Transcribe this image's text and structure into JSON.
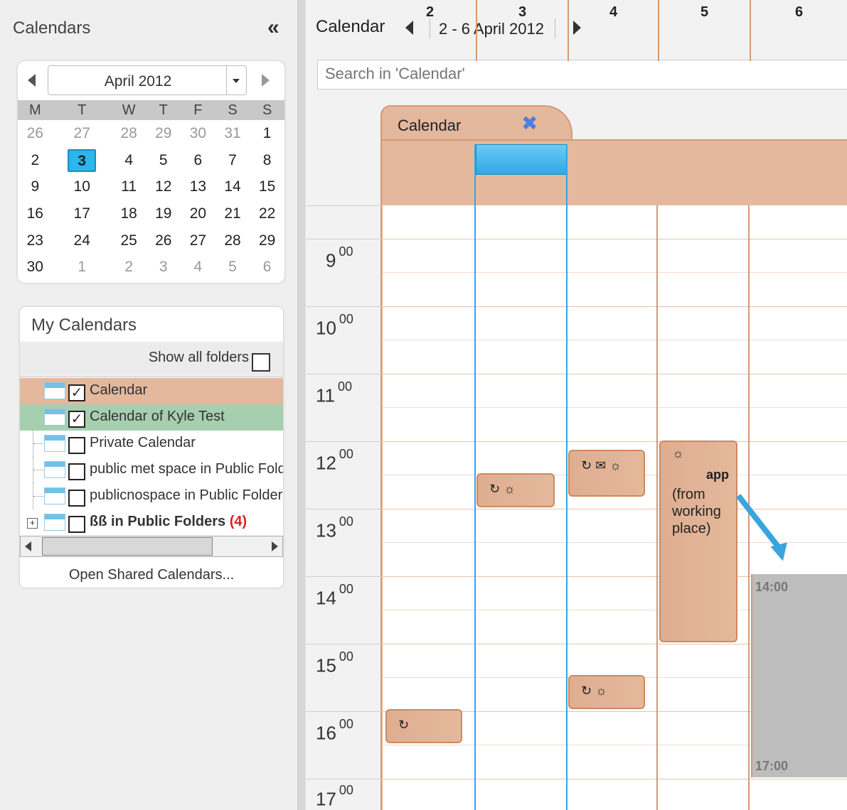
{
  "left": {
    "title": "Calendars",
    "collapse_icon": "«",
    "mini_calendar": {
      "month_label": "April 2012",
      "weekdays": [
        "M",
        "T",
        "W",
        "T",
        "F",
        "S",
        "S"
      ],
      "weeks": [
        [
          "26",
          "27",
          "28",
          "29",
          "30",
          "31",
          "1"
        ],
        [
          "2",
          "3",
          "4",
          "5",
          "6",
          "7",
          "8"
        ],
        [
          "9",
          "10",
          "11",
          "12",
          "13",
          "14",
          "15"
        ],
        [
          "16",
          "17",
          "18",
          "19",
          "20",
          "21",
          "22"
        ],
        [
          "23",
          "24",
          "25",
          "26",
          "27",
          "28",
          "29"
        ],
        [
          "30",
          "1",
          "2",
          "3",
          "4",
          "5",
          "6"
        ]
      ],
      "today": "3"
    },
    "my_calendars": {
      "title": "My Calendars",
      "show_all_label": "Show all folders",
      "items": [
        {
          "label": "Calendar",
          "checked": "✓",
          "bg": "#e4b89c"
        },
        {
          "label": "Calendar of Kyle Test",
          "checked": "✓",
          "bg": "#a6cfb0"
        },
        {
          "label": "Private Calendar",
          "checked": ""
        },
        {
          "label": "public met space in Public Folders",
          "checked": ""
        },
        {
          "label": "publicnospace in Public Folders",
          "checked": ""
        },
        {
          "label": "ßß in Public Folders",
          "count": "(4)",
          "checked": ""
        }
      ],
      "open_shared": "Open Shared Calendars..."
    }
  },
  "main": {
    "title": "Calendar",
    "date_range": "2 - 6 April 2012",
    "search_placeholder": "Search in 'Calendar'",
    "tab_label": "Calendar",
    "days": [
      "2",
      "3",
      "4",
      "5",
      "6"
    ],
    "hours": [
      "9",
      "10",
      "11",
      "12",
      "13",
      "14",
      "15",
      "16",
      "17"
    ],
    "hour_suffix": "00",
    "events": {
      "tue_icons": "↻ ☼",
      "wed_icons": "↻ ✉ ☼",
      "thu_icon": "☼",
      "thu_title": "app",
      "thu_text": "(from working place)",
      "wed_late_icons": "↻ ☼",
      "mon_icons": "↻"
    },
    "blocked": {
      "start": "14:00",
      "end": "17:00"
    }
  }
}
